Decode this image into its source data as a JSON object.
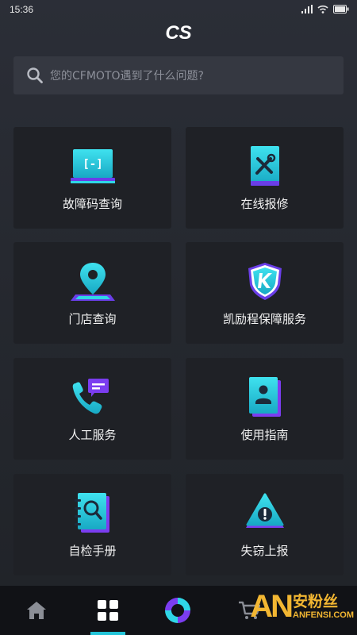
{
  "status_bar": {
    "time": "15:36",
    "icons": [
      "signal-icon",
      "wifi-icon",
      "battery-icon"
    ]
  },
  "header": {
    "logo_text": "CS"
  },
  "search": {
    "placeholder": "您的CFMOTO遇到了什么问题?"
  },
  "tiles": [
    {
      "label": "故障码查询",
      "icon": "error-code-monitor-icon"
    },
    {
      "label": "在线报修",
      "icon": "repair-tools-icon"
    },
    {
      "label": "门店查询",
      "icon": "store-location-pin-icon"
    },
    {
      "label": "凯励程保障服务",
      "icon": "k-shield-icon"
    },
    {
      "label": "人工服务",
      "icon": "phone-chat-icon"
    },
    {
      "label": "使用指南",
      "icon": "user-guide-book-icon"
    },
    {
      "label": "自检手册",
      "icon": "self-check-notebook-icon"
    },
    {
      "label": "失窃上报",
      "icon": "warning-triangle-icon"
    }
  ],
  "bottom_nav": {
    "items": [
      "home-icon",
      "grid-icon",
      "brand-swirl-icon",
      "cart-icon"
    ],
    "active_index": 1,
    "accent_color": "#22c4d8"
  },
  "watermark": {
    "letters": "AN",
    "chinese": "安粉丝",
    "english": "ANFENSI.COM"
  },
  "colors": {
    "accent_cyan": "#2fd6e6",
    "accent_purple": "#7b3df0",
    "tile_bg": "#1f2126"
  }
}
